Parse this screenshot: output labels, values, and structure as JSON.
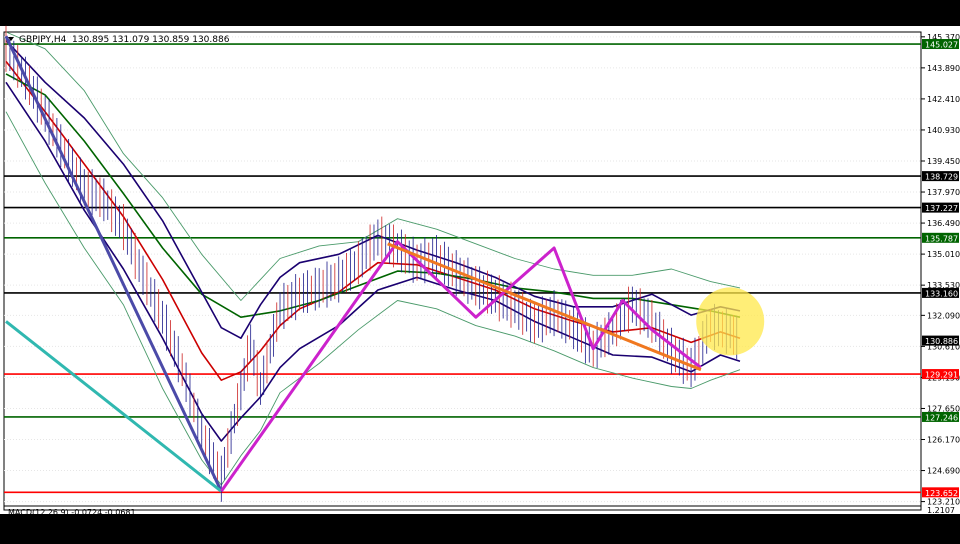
{
  "header": {
    "symbol": "GBPJPY,H4",
    "ohlc": "130.895 131.079 130.859 130.886"
  },
  "sub_panel": {
    "label": "MACD(12,26,9) -0.0724 -0.0681",
    "value": "1.2107"
  },
  "chart_data": {
    "type": "line",
    "title": "GBPJPY,H4",
    "xlabel": "",
    "ylabel": "",
    "ylim": [
      123.0,
      145.6
    ],
    "xlim": [
      0,
      100
    ],
    "grid": true,
    "y_ticks": [
      "145.370",
      "143.890",
      "142.410",
      "140.930",
      "139.450",
      "137.970",
      "136.490",
      "135.010",
      "133.530",
      "132.090",
      "130.610",
      "129.130",
      "127.650",
      "126.170",
      "124.690",
      "123.210"
    ],
    "y_tick_values": [
      145.37,
      143.89,
      142.41,
      140.93,
      139.45,
      137.97,
      136.49,
      135.01,
      133.53,
      132.09,
      130.61,
      129.13,
      127.65,
      126.17,
      124.69,
      123.21
    ],
    "horizontal_levels": [
      {
        "value": 145.027,
        "label": "145.027",
        "color": "#006400"
      },
      {
        "value": 138.729,
        "label": "138.729",
        "color": "#000000"
      },
      {
        "value": 137.227,
        "label": "137.227",
        "color": "#000000"
      },
      {
        "value": 135.787,
        "label": "135.787",
        "color": "#006400"
      },
      {
        "value": 133.16,
        "label": "133.160",
        "color": "#000000"
      },
      {
        "value": 129.291,
        "label": "129.291",
        "color": "#ff0000"
      },
      {
        "value": 127.246,
        "label": "127.246",
        "color": "#006400"
      },
      {
        "value": 123.652,
        "label": "123.652",
        "color": "#ff0000"
      }
    ],
    "current_price": {
      "value": 130.886,
      "label": "130.886"
    },
    "price_series": {
      "name": "",
      "x": [
        0,
        2,
        4,
        6,
        8,
        10,
        12,
        14,
        16,
        18,
        20,
        22,
        23,
        24,
        25,
        26,
        27,
        28,
        30,
        32,
        34,
        36,
        38,
        40,
        42,
        44,
        46,
        48,
        50,
        52,
        54,
        56,
        58,
        60,
        62,
        64,
        66,
        68,
        70,
        72,
        74,
        75
      ],
      "y": [
        144.8,
        143.4,
        141.7,
        139.8,
        138.2,
        137.6,
        136.3,
        134.0,
        132.0,
        129.5,
        126.5,
        124.3,
        126.5,
        128.5,
        130.8,
        128.6,
        130.5,
        132.4,
        133.1,
        133.4,
        133.8,
        134.6,
        135.8,
        135.3,
        134.6,
        134.9,
        134.1,
        133.5,
        133.0,
        132.5,
        131.7,
        132.2,
        131.5,
        130.5,
        131.4,
        132.6,
        131.8,
        130.4,
        129.6,
        131.6,
        131.3,
        130.886
      ]
    },
    "series": [
      {
        "color": "#cc0000",
        "x": [
          0,
          4,
          8,
          12,
          16,
          20,
          22,
          24,
          26,
          28,
          30,
          34,
          38,
          42,
          46,
          50,
          54,
          58,
          62,
          66,
          70,
          73,
          75
        ],
        "y": [
          144.2,
          141.8,
          139.3,
          136.8,
          133.8,
          130.3,
          129.0,
          129.4,
          130.4,
          131.6,
          132.4,
          133.2,
          134.6,
          134.5,
          133.9,
          133.3,
          132.4,
          131.8,
          131.3,
          131.5,
          130.8,
          131.3,
          131.0
        ]
      },
      {
        "color": "#006400",
        "x": [
          0,
          4,
          8,
          12,
          16,
          20,
          24,
          28,
          32,
          36,
          40,
          44,
          48,
          52,
          56,
          60,
          64,
          68,
          72,
          75
        ],
        "y": [
          143.6,
          142.6,
          140.4,
          137.9,
          135.3,
          133.1,
          132.0,
          132.3,
          132.8,
          133.5,
          134.2,
          134.1,
          133.8,
          133.4,
          133.2,
          132.9,
          132.9,
          132.6,
          132.3,
          132.0
        ]
      },
      {
        "color": "#1a0070",
        "x": [
          0,
          4,
          8,
          12,
          16,
          20,
          22,
          24,
          26,
          28,
          30,
          34,
          38,
          42,
          46,
          50,
          54,
          58,
          62,
          66,
          70,
          73,
          75
        ],
        "y": [
          145.2,
          143.2,
          141.5,
          139.3,
          136.6,
          133.2,
          131.5,
          131.0,
          132.6,
          133.9,
          134.6,
          135.0,
          135.9,
          135.2,
          134.6,
          133.9,
          133.0,
          132.5,
          132.5,
          133.1,
          132.1,
          132.5,
          132.3
        ]
      },
      {
        "color": "#1a0070",
        "x": [
          0,
          4,
          8,
          12,
          16,
          20,
          22,
          24,
          26,
          28,
          30,
          34,
          38,
          42,
          46,
          50,
          54,
          58,
          62,
          66,
          70,
          73,
          75
        ],
        "y": [
          143.2,
          140.4,
          137.1,
          134.3,
          131.0,
          127.4,
          126.1,
          127.2,
          128.2,
          129.6,
          130.5,
          131.6,
          133.3,
          133.9,
          133.3,
          132.8,
          131.8,
          131.0,
          130.2,
          130.1,
          129.4,
          130.2,
          129.9
        ]
      },
      {
        "color": "#4a9a6a",
        "x": [
          0,
          4,
          8,
          12,
          16,
          20,
          24,
          28,
          32,
          36,
          40,
          44,
          48,
          52,
          56,
          60,
          64,
          68,
          72,
          75
        ],
        "y": [
          145.6,
          144.8,
          142.8,
          139.8,
          137.7,
          135.0,
          132.8,
          134.8,
          135.4,
          135.6,
          136.7,
          136.2,
          135.5,
          134.8,
          134.3,
          134.0,
          134.0,
          134.3,
          133.7,
          133.4
        ]
      },
      {
        "color": "#4a9a6a",
        "x": [
          0,
          4,
          8,
          12,
          16,
          20,
          22,
          24,
          26,
          28,
          32,
          36,
          40,
          44,
          48,
          52,
          56,
          60,
          64,
          68,
          70,
          72,
          75
        ],
        "y": [
          141.8,
          138.4,
          135.3,
          132.6,
          128.6,
          125.2,
          124.0,
          125.4,
          126.6,
          128.4,
          129.8,
          131.4,
          132.8,
          132.4,
          131.6,
          131.1,
          130.4,
          129.6,
          129.1,
          128.7,
          128.6,
          129.0,
          129.5
        ]
      }
    ],
    "trendlines": [
      {
        "color": "#4b4aa8",
        "x": [
          0,
          22
        ],
        "y": [
          145.4,
          123.7
        ]
      },
      {
        "color": "#30b8b0",
        "x": [
          0,
          22
        ],
        "y": [
          131.8,
          123.7
        ]
      },
      {
        "color": "#cc22cc",
        "x": [
          22,
          40,
          48,
          56,
          60,
          63,
          66,
          71
        ],
        "y": [
          123.7,
          135.6,
          132.0,
          135.3,
          130.5,
          132.8,
          131.4,
          129.6
        ]
      },
      {
        "color": "#f07820",
        "x": [
          39,
          71
        ],
        "y": [
          135.5,
          129.5
        ]
      }
    ],
    "highlight": {
      "x": 74,
      "y": 131.8,
      "color": "#ffe84a"
    }
  }
}
